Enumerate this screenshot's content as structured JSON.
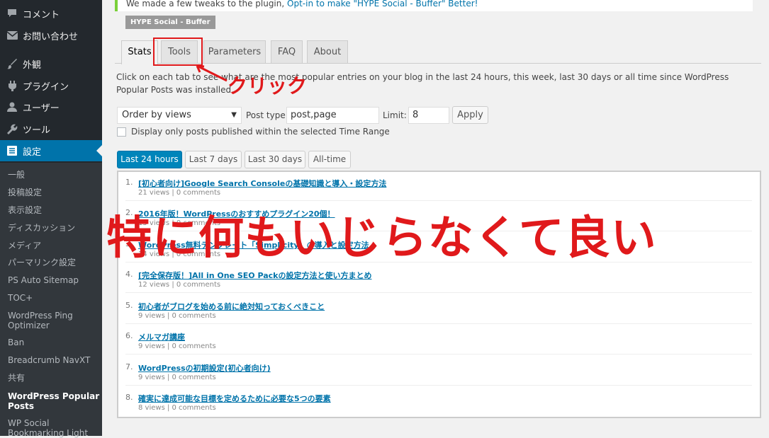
{
  "sidebar": {
    "menu": [
      {
        "label": "コメント",
        "icon": "comment-icon"
      },
      {
        "label": "お問い合わせ",
        "icon": "mail-icon"
      },
      {
        "label": "外観",
        "icon": "brush-icon"
      },
      {
        "label": "プラグイン",
        "icon": "plugin-icon"
      },
      {
        "label": "ユーザー",
        "icon": "user-icon"
      },
      {
        "label": "ツール",
        "icon": "wrench-icon"
      },
      {
        "label": "設定",
        "icon": "settings-icon"
      }
    ],
    "submenu": [
      "一般",
      "投稿設定",
      "表示設定",
      "ディスカッション",
      "メディア",
      "パーマリンク設定",
      "PS Auto Sitemap",
      "TOC+",
      "WordPress Ping Optimizer",
      "Ban",
      "Breadcrumb NavXT",
      "共有",
      "WordPress Popular Posts",
      "WP Social Bookmarking Light"
    ]
  },
  "notice": {
    "text": "We made a few tweaks to the plugin, ",
    "link": "Opt-in to make \"HYPE Social - Buffer\" Better!"
  },
  "plugin_badge": "HYPE Social - Buffer",
  "tabs": [
    "Stats",
    "Tools",
    "Parameters",
    "FAQ",
    "About"
  ],
  "description": "Click on each tab to see what are the most popular entries on your blog in the last 24 hours, this week, last 30 days or all time since WordPress Popular Posts was installed.",
  "annotation_click": "クリック",
  "filters": {
    "order_by": "Order by views",
    "post_type_label": "Post type:",
    "post_type_value": "post,page",
    "limit_label": "Limit:",
    "limit_value": "8",
    "apply": "Apply",
    "checkbox_label": "Display only posts published within the selected Time Range"
  },
  "ranges": [
    "Last 24 hours",
    "Last 7 days",
    "Last 30 days",
    "All-time"
  ],
  "entries": [
    {
      "num": "1.",
      "title": "[初心者向け]Google Search Consoleの基礎知識と導入・設定方法",
      "stats": "21 views | 0 comments"
    },
    {
      "num": "2.",
      "title": "2016年版！WordPressのおすすめプラグイン20個！",
      "stats": "15 views | 0 comments"
    },
    {
      "num": "3.",
      "title": "WordPress無料テンプレート「Simplicity」の導入と設定方法",
      "stats": "14 views | 0 comments"
    },
    {
      "num": "4.",
      "title": "[完全保存版！]All in One SEO Packの設定方法と使い方まとめ",
      "stats": "12 views | 0 comments"
    },
    {
      "num": "5.",
      "title": "初心者がブログを始める前に絶対知っておくべきこと",
      "stats": "9 views | 0 comments"
    },
    {
      "num": "6.",
      "title": "メルマガ講座",
      "stats": "9 views | 0 comments"
    },
    {
      "num": "7.",
      "title": "WordPressの初期設定(初心者向け)",
      "stats": "9 views | 0 comments"
    },
    {
      "num": "8.",
      "title": "確実に達成可能な目標を定めるために必要な5つの要素",
      "stats": "8 views | 0 comments"
    }
  ],
  "overlay_text": "特に何もいじらなくて良い"
}
